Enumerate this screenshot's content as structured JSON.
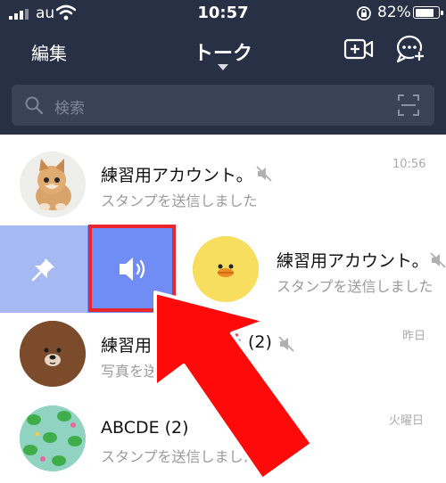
{
  "status_bar": {
    "carrier": "au",
    "time": "10:57",
    "battery": "82%"
  },
  "header": {
    "edit_label": "編集",
    "title": "トーク"
  },
  "search": {
    "placeholder": "検索"
  },
  "chats": [
    {
      "name": "練習用アカウント。",
      "preview": "スタンプを送信しました",
      "time": "10:56",
      "muted": true
    },
    {
      "name": "練習用アカウント。",
      "preview": "スタンプを送信しました",
      "time": "",
      "muted": true,
      "swiped": true
    },
    {
      "name": "練習用ク",
      "name_suffix": "(2)",
      "preview": "写真を送",
      "time": "昨日",
      "muted": true
    },
    {
      "name": "ABCDE (2)",
      "preview": "スタンプを送信しました",
      "time": "火曜日",
      "muted": false
    }
  ],
  "swipe_actions": {
    "pin_icon": "pin-icon",
    "unmute_icon": "speaker-icon"
  },
  "colors": {
    "header_bg": "#283046",
    "search_bg": "#3a4258",
    "pin_action": "#a7b9f2",
    "mute_action": "#6f8df5",
    "annotation": "#e8262b"
  }
}
